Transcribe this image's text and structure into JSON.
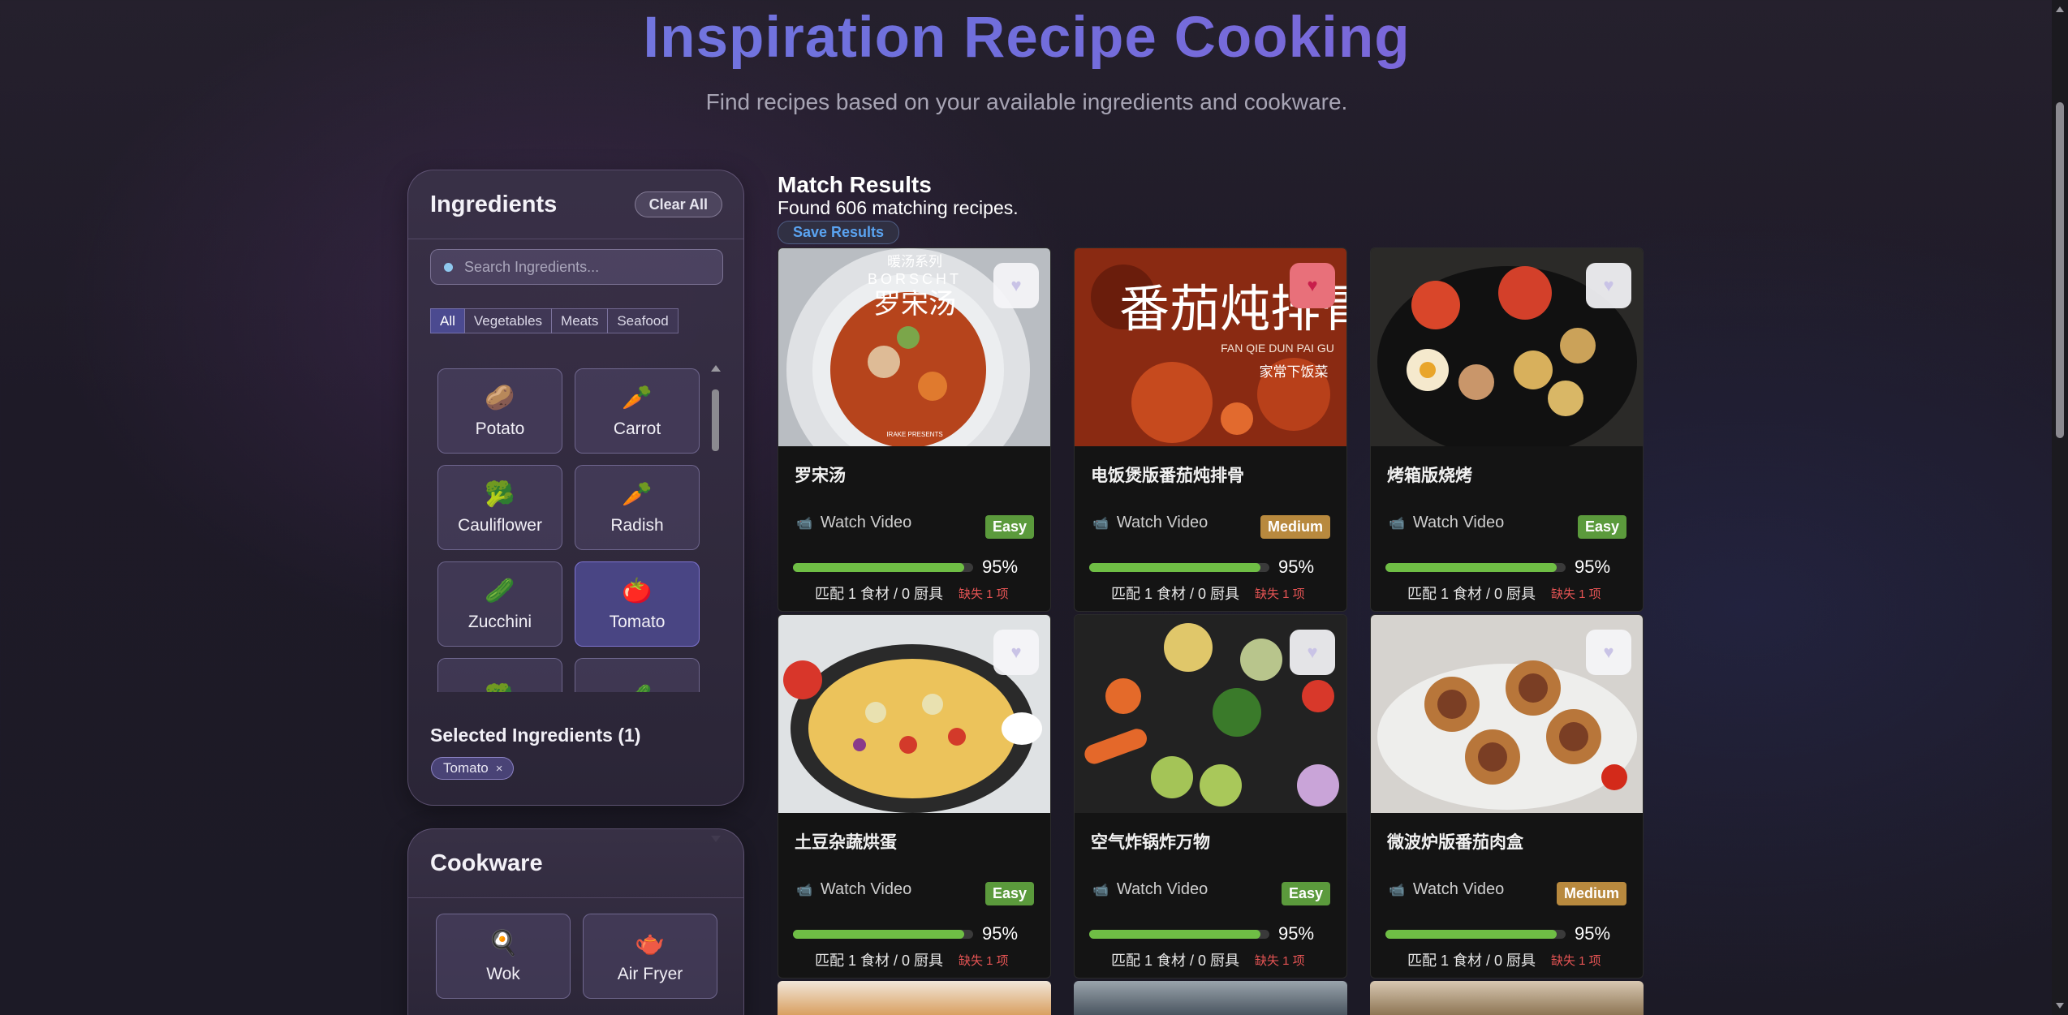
{
  "header": {
    "title": "Inspiration Recipe Cooking",
    "subtitle": "Find recipes based on your available ingredients and cookware."
  },
  "ingredients_panel": {
    "title": "Ingredients",
    "clear_label": "Clear All",
    "search_placeholder": "Search Ingredients...",
    "filters": [
      "All",
      "Vegetables",
      "Meats",
      "Seafood"
    ],
    "active_filter": "All",
    "items": [
      {
        "label": "Potato",
        "icon": "🥔"
      },
      {
        "label": "Carrot",
        "icon": "🥕"
      },
      {
        "label": "Cauliflower",
        "icon": "🥦"
      },
      {
        "label": "Radish",
        "icon": "🥕"
      },
      {
        "label": "Zucchini",
        "icon": "🥒"
      },
      {
        "label": "Tomato",
        "icon": "🍅",
        "selected": true
      },
      {
        "label": "",
        "icon": "🥦"
      },
      {
        "label": "",
        "icon": "🥒"
      }
    ],
    "selected_title": "Selected Ingredients (1)",
    "selected": [
      "Tomato"
    ]
  },
  "cookware_panel": {
    "title": "Cookware",
    "items": [
      {
        "label": "Wok",
        "icon": "🍳"
      },
      {
        "label": "Air Fryer",
        "icon": "🫖"
      }
    ]
  },
  "results": {
    "title": "Match Results",
    "count_text": "Found 606 matching recipes.",
    "save_label": "Save Results",
    "watch_label": "Watch Video",
    "recipes": [
      {
        "name": "罗宋汤",
        "difficulty": "Easy",
        "match_pct": "95%",
        "match_value": 0.95,
        "match_text": "匹配 1 食材 / 0 厨具",
        "missing_text": "缺失 1 项",
        "favorite": false,
        "img": "soup",
        "overlay_title": "暖汤系列",
        "overlay_sub": "BORSCHT",
        "overlay_cn": "罗宋汤",
        "overlay_foot": "IRAKE PRESENTS"
      },
      {
        "name": "电饭煲版番茄炖排骨",
        "difficulty": "Medium",
        "match_pct": "95%",
        "match_value": 0.95,
        "match_text": "匹配 1 食材 / 0 厨具",
        "missing_text": "缺失 1 项",
        "favorite": true,
        "img": "ribs",
        "overlay_cn": "番茄炖排骨",
        "overlay_sub": "FAN QIE DUN PAI GU",
        "overlay_foot": "家常下饭菜"
      },
      {
        "name": "烤箱版烧烤",
        "difficulty": "Easy",
        "match_pct": "95%",
        "match_value": 0.95,
        "match_text": "匹配 1 食材 / 0 厨具",
        "missing_text": "缺失 1 项",
        "favorite": false,
        "img": "skillet"
      },
      {
        "name": "土豆杂蔬烘蛋",
        "difficulty": "Easy",
        "match_pct": "95%",
        "match_value": 0.95,
        "match_text": "匹配 1 食材 / 0 厨具",
        "missing_text": "缺失 1 项",
        "favorite": false,
        "img": "frittata"
      },
      {
        "name": "空气炸锅炸万物",
        "difficulty": "Easy",
        "match_pct": "95%",
        "match_value": 0.95,
        "match_text": "匹配 1 食材 / 0 厨具",
        "missing_text": "缺失 1 项",
        "favorite": false,
        "img": "veggies"
      },
      {
        "name": "微波炉版番茄肉盒",
        "difficulty": "Medium",
        "match_pct": "95%",
        "match_value": 0.95,
        "match_text": "匹配 1 食材 / 0 厨具",
        "missing_text": "缺失 1 项",
        "favorite": false,
        "img": "tarts"
      }
    ]
  },
  "colors": {
    "easy": "#5b9a3c",
    "medium": "#b8893e",
    "progress": "#6fbe45",
    "missing": "#e65454",
    "title_gradient": [
      "#7a84e6",
      "#8a5fd6"
    ]
  },
  "icons": {
    "search": "search-icon",
    "heart": "heart-icon",
    "video": "video-camera-icon"
  }
}
